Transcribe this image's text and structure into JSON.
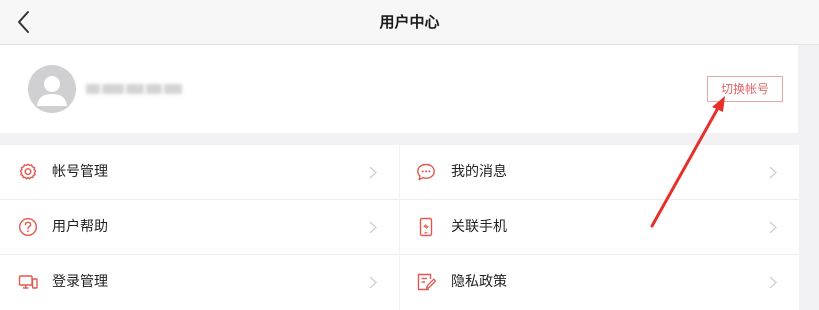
{
  "header": {
    "title": "用户中心",
    "back_icon": "chevron-left-icon"
  },
  "profile": {
    "avatar_icon": "user-avatar-icon",
    "switch_account_label": "切换帐号"
  },
  "menu": {
    "left": [
      {
        "label": "帐号管理",
        "icon": "gear-icon"
      },
      {
        "label": "用户帮助",
        "icon": "help-circle-icon"
      },
      {
        "label": "登录管理",
        "icon": "devices-icon"
      }
    ],
    "right": [
      {
        "label": "我的消息",
        "icon": "message-icon"
      },
      {
        "label": "关联手机",
        "icon": "phone-icon"
      },
      {
        "label": "隐私政策",
        "icon": "policy-icon"
      }
    ]
  },
  "colors": {
    "accent": "#e06666",
    "annotation_arrow": "#e8302a"
  }
}
